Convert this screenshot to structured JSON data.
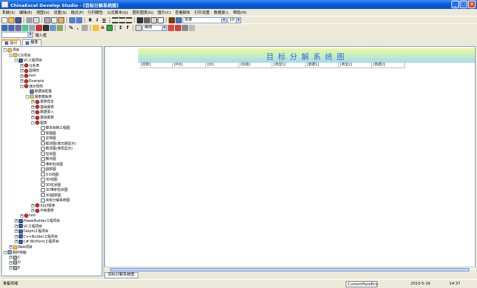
{
  "window": {
    "title": "ChinaExcel Develop Studio - [目标分解系统图]"
  },
  "menu": [
    "系统(S)",
    "编辑(E)",
    "视图(V)",
    "设置(S)",
    "格式(F)",
    "行列属性",
    "公式脚本(G)",
    "图形图表(G)",
    "图片(C)",
    "查看脚本",
    "打印设置",
    "数据录入",
    "帮助(H)"
  ],
  "format_bar": {
    "font": "宋体",
    "size": "10",
    "border_style": "细线"
  },
  "input_row": {
    "cell_ref": "",
    "label": "输入框"
  },
  "panel_tabs": [
    "设计",
    "报表"
  ],
  "tree": [
    {
      "label": "项目",
      "depth": 0,
      "icon": "folder",
      "toggle": "-"
    },
    {
      "label": "C/S项目",
      "depth": 1,
      "icon": "folder",
      "toggle": "-"
    },
    {
      "label": "VC工程项目",
      "depth": 2,
      "icon": "proj",
      "toggle": "-"
    },
    {
      "label": "分析表",
      "depth": 3,
      "icon": "red",
      "toggle": "+"
    },
    {
      "label": "圆柄形",
      "depth": 3,
      "icon": "red",
      "toggle": "+"
    },
    {
      "label": "test",
      "depth": 3,
      "icon": "red",
      "toggle": "+"
    },
    {
      "label": "Example",
      "depth": 3,
      "icon": "red",
      "toggle": "+"
    },
    {
      "label": "演示样例",
      "depth": 3,
      "icon": "red",
      "toggle": "-"
    },
    {
      "label": "数据库配置",
      "depth": 4,
      "icon": "db",
      "toggle": ""
    },
    {
      "label": "报表模板类",
      "depth": 4,
      "icon": "folder",
      "toggle": "-"
    },
    {
      "label": "报表样本",
      "depth": 5,
      "icon": "red",
      "toggle": "+"
    },
    {
      "label": "基础报表",
      "depth": 5,
      "icon": "red",
      "toggle": "+"
    },
    {
      "label": "数据录入",
      "depth": 5,
      "icon": "red",
      "toggle": "+"
    },
    {
      "label": "基础报表",
      "depth": 5,
      "icon": "red",
      "toggle": "+"
    },
    {
      "label": "图表",
      "depth": 5,
      "icon": "red",
      "toggle": "-"
    },
    {
      "label": "脚本绘制工程图",
      "depth": 6,
      "icon": "rpt",
      "toggle": ""
    },
    {
      "label": "饼图图",
      "depth": 6,
      "icon": "rpt",
      "toggle": ""
    },
    {
      "label": "甘特图",
      "depth": 6,
      "icon": "rpt",
      "toggle": ""
    },
    {
      "label": "概述图(按日期显示)",
      "depth": 6,
      "icon": "rpt",
      "toggle": ""
    },
    {
      "label": "概述图(按周显示)",
      "depth": 6,
      "icon": "rpt",
      "toggle": ""
    },
    {
      "label": "柱状图",
      "depth": 6,
      "icon": "rpt",
      "toggle": ""
    },
    {
      "label": "散点图",
      "depth": 6,
      "icon": "rpt",
      "toggle": ""
    },
    {
      "label": "堆积柱状图",
      "depth": 6,
      "icon": "rpt",
      "toggle": ""
    },
    {
      "label": "圆饼图",
      "depth": 6,
      "icon": "rpt",
      "toggle": ""
    },
    {
      "label": "3-D线图",
      "depth": 6,
      "icon": "rpt",
      "toggle": ""
    },
    {
      "label": "3D线图",
      "depth": 6,
      "icon": "rpt",
      "toggle": ""
    },
    {
      "label": "3D柱状图",
      "depth": 6,
      "icon": "rpt",
      "toggle": ""
    },
    {
      "label": "3D堆积柱状图",
      "depth": 6,
      "icon": "rpt",
      "toggle": ""
    },
    {
      "label": "3D圆饼图",
      "depth": 6,
      "icon": "rpt",
      "toggle": ""
    },
    {
      "label": "目标分解系统图",
      "depth": 6,
      "icon": "rpt",
      "toggle": ""
    },
    {
      "label": "XSLT报表",
      "depth": 5,
      "icon": "red",
      "toggle": "+"
    },
    {
      "label": "中级报表",
      "depth": 5,
      "icon": "red",
      "toggle": "+"
    },
    {
      "label": "test",
      "depth": 3,
      "icon": "red",
      "toggle": "+"
    },
    {
      "label": "PowerBuilder工程项目",
      "depth": 2,
      "icon": "proj",
      "toggle": "+"
    },
    {
      "label": "VC工程项目",
      "depth": 2,
      "icon": "proj",
      "toggle": "+"
    },
    {
      "label": "Delphi工程项目",
      "depth": 2,
      "icon": "proj",
      "toggle": "+"
    },
    {
      "label": "C++Builder工程项目",
      "depth": 2,
      "icon": "proj",
      "toggle": "+"
    },
    {
      "label": "C# WinForm工程项目",
      "depth": 2,
      "icon": "proj",
      "toggle": "+"
    },
    {
      "label": "Web项目",
      "depth": 1,
      "icon": "folder",
      "toggle": "+"
    },
    {
      "label": "我的电脑",
      "depth": 0,
      "icon": "pc",
      "toggle": "-"
    },
    {
      "label": "C",
      "depth": 1,
      "icon": "drv",
      "toggle": "+"
    },
    {
      "label": "D",
      "depth": 1,
      "icon": "drv",
      "toggle": "+"
    },
    {
      "label": "E",
      "depth": 1,
      "icon": "drv",
      "toggle": "+"
    }
  ],
  "report": {
    "title": "目标分解系统图",
    "columns": [
      "[层数]",
      "[PID]",
      "[ID]",
      "[标题]",
      "[类型1]",
      "[数据1]",
      "[类型2]",
      "[数据2]"
    ]
  },
  "sheet_tab": "目标分解系统图",
  "status": {
    "left": "准备就绪",
    "mode": "CustomFaceEnv",
    "date": "2010-5-16",
    "time": "14:37"
  }
}
